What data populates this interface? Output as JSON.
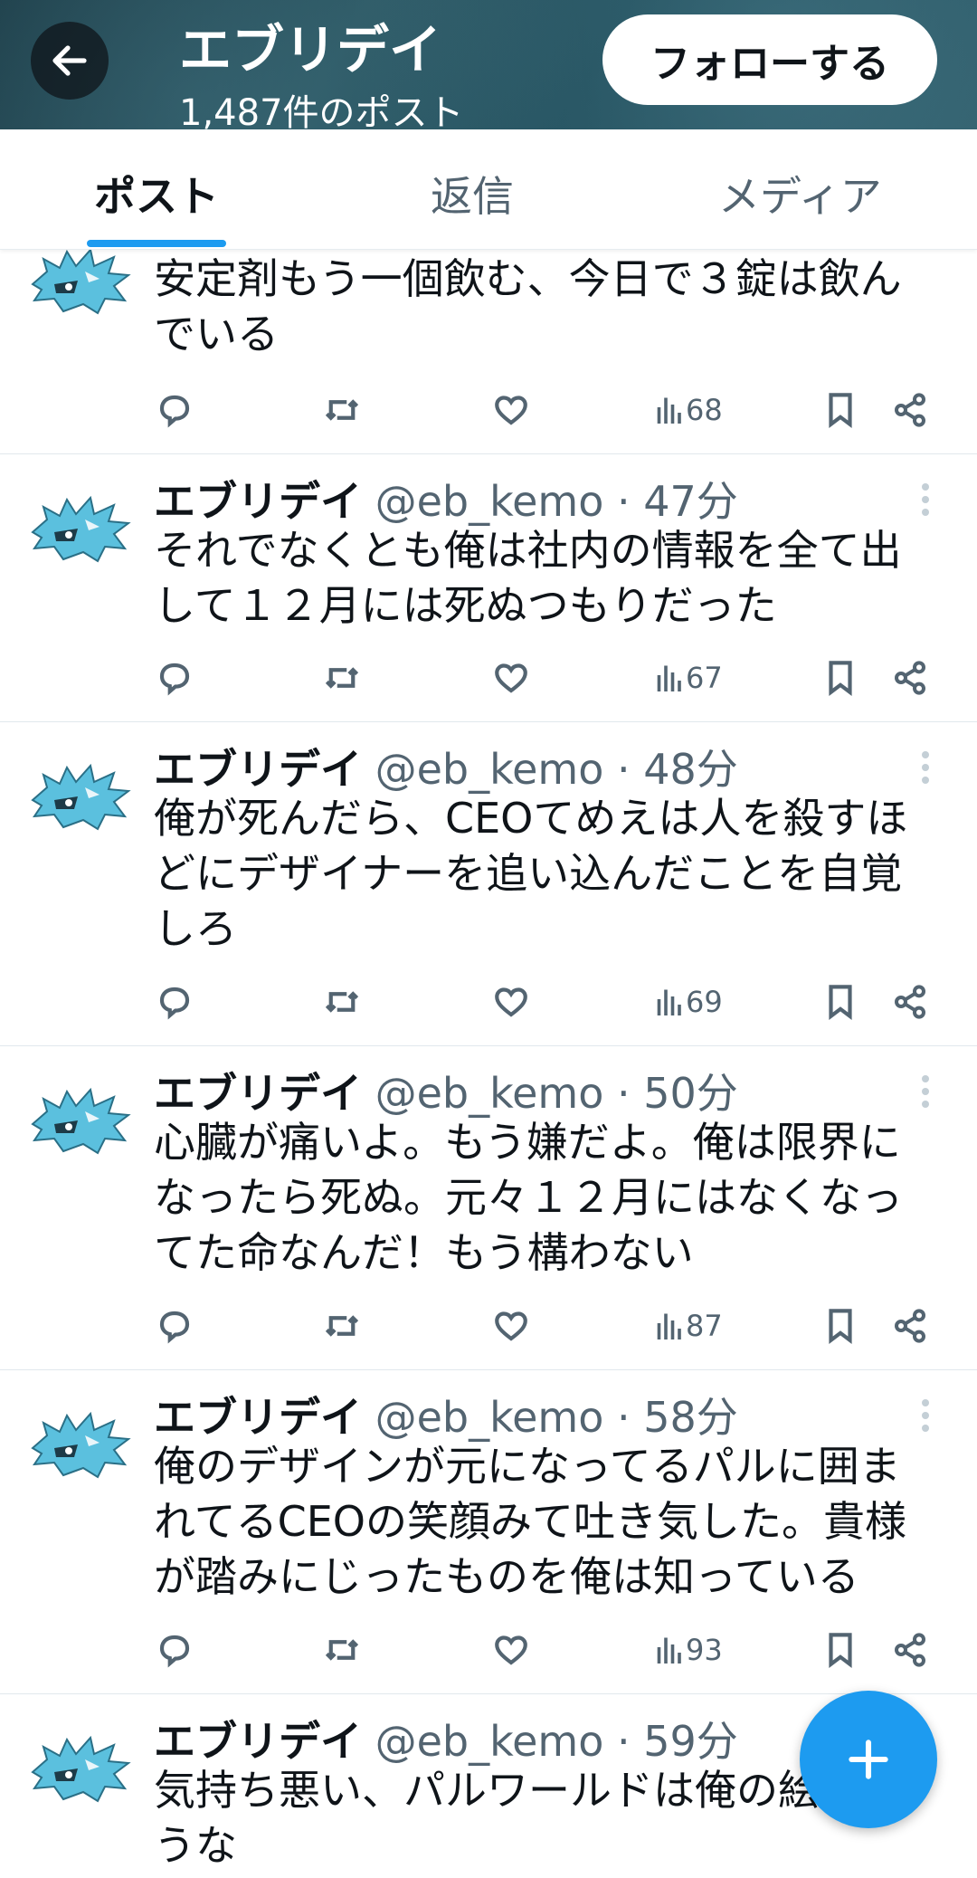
{
  "header": {
    "title": "エブリデイ",
    "post_count": "1,487件のポスト",
    "follow_label": "フォローする"
  },
  "tabs": [
    {
      "label": "ポスト",
      "active": true
    },
    {
      "label": "返信",
      "active": false
    },
    {
      "label": "メディア",
      "active": false
    }
  ],
  "tweets": [
    {
      "name": "",
      "handle": "",
      "time": "",
      "text": "安定剤もう一個飲む、今日で３錠は飲んでいる",
      "views": "68"
    },
    {
      "name": "エブリデイ",
      "handle": "@eb_kemo",
      "time": "47分",
      "text": "それでなくとも俺は社内の情報を全て出して１２月には死ぬつもりだった",
      "views": "67"
    },
    {
      "name": "エブリデイ",
      "handle": "@eb_kemo",
      "time": "48分",
      "text": "俺が死んだら、CEOてめえは人を殺すほどにデザイナーを追い込んだことを自覚しろ",
      "views": "69"
    },
    {
      "name": "エブリデイ",
      "handle": "@eb_kemo",
      "time": "50分",
      "text": "心臓が痛いよ。もう嫌だよ。俺は限界になったら死ぬ。元々１２月にはなくなってた命なんだ！もう構わない",
      "views": "87"
    },
    {
      "name": "エブリデイ",
      "handle": "@eb_kemo",
      "time": "58分",
      "text": "俺のデザインが元になってるパルに囲まれてるCEOの笑顔みて吐き気した。貴様が踏みにじったものを俺は知っている",
      "views": "93"
    },
    {
      "name": "エブリデイ",
      "handle": "@eb_kemo",
      "time": "59分",
      "text": "気持ち悪い、パルワールドは俺の絵を使うな",
      "views": ""
    }
  ],
  "icons": {
    "back": "arrow-left-icon",
    "reply": "reply-icon",
    "retweet": "retweet-icon",
    "like": "heart-icon",
    "views": "views-icon",
    "bookmark": "bookmark-icon",
    "share": "share-icon",
    "more": "more-vertical-icon",
    "compose": "plus-icon"
  },
  "colors": {
    "accent": "#1d9bf0",
    "avatar": "#5bc0de"
  }
}
